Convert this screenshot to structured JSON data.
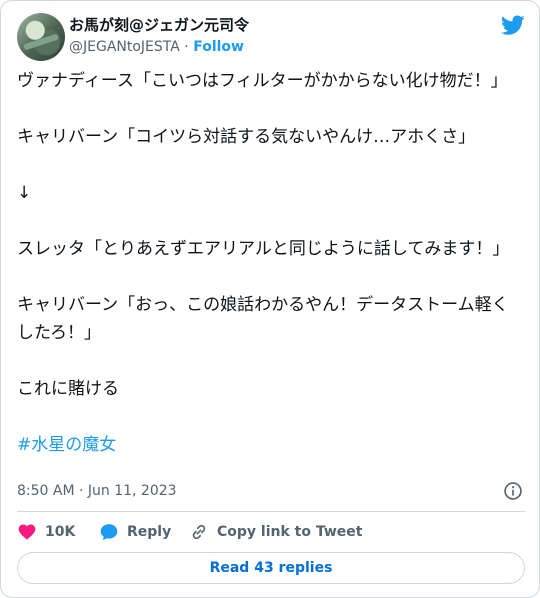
{
  "author": {
    "display_name": "お馬が刻@ジェガン元司令",
    "handle": "@JEGANtoJESTA",
    "separator": "·",
    "follow_label": "Follow"
  },
  "tweet": {
    "text": "ヴァナディース「こいつはフィルターがかからない化け物だ！」\n\nキャリバーン「コイツら対話する気ないやんけ…アホくさ」\n\n↓\n\nスレッタ「とりあえずエアリアルと同じように話してみます！」\n\nキャリバーン「おっ、この娘話わかるやん！データストーム軽くしたろ！」\n\nこれに賭ける\n\n",
    "hashtag": "#水星の魔女",
    "timestamp": "8:50 AM · Jun 11, 2023"
  },
  "actions": {
    "like_count": "10K",
    "reply_label": "Reply",
    "copy_label": "Copy link to Tweet"
  },
  "read_replies_label": "Read 43 replies",
  "colors": {
    "accent": "#1d9bf0",
    "like": "#f91880",
    "text": "#0f1419",
    "muted": "#536471",
    "border": "#cfd9de"
  },
  "icons": [
    "twitter-bird-icon",
    "info-icon",
    "heart-icon",
    "reply-bubble-icon",
    "link-icon"
  ]
}
